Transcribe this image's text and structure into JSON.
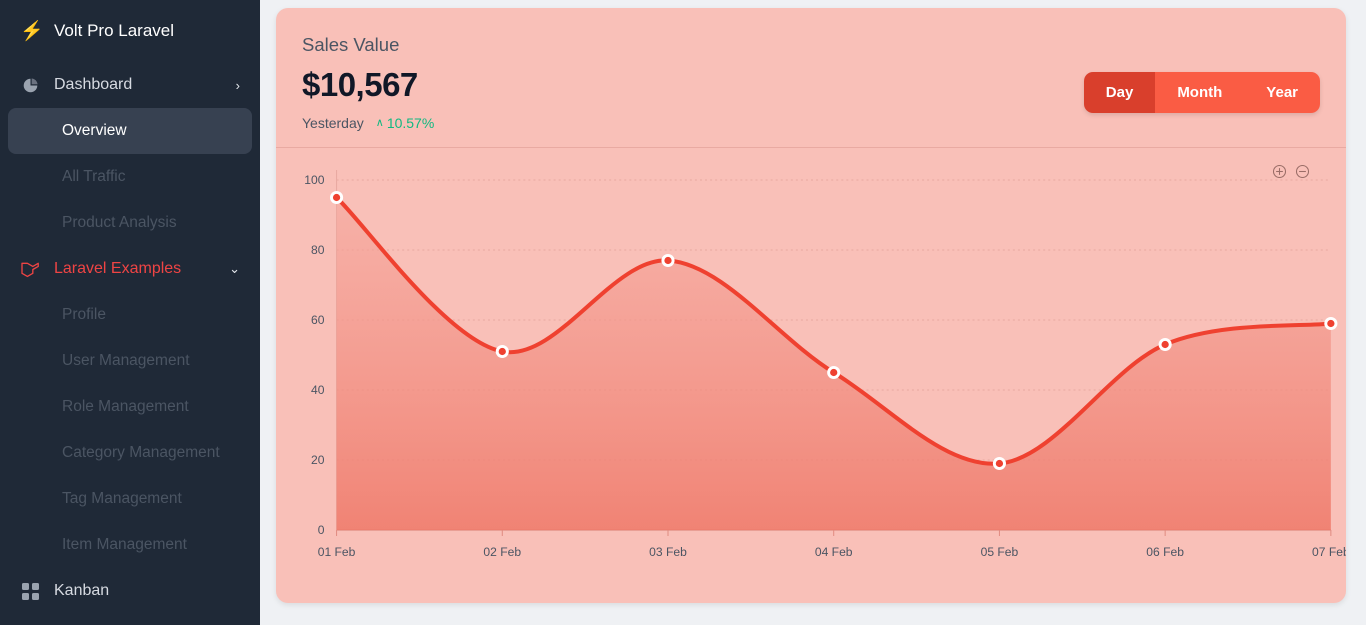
{
  "sidebar": {
    "brand": {
      "label": "Volt Pro Laravel",
      "icon": "bolt-icon"
    },
    "items": [
      {
        "label": "Dashboard",
        "icon": "pie-chart-icon",
        "chevron": "›",
        "state": "parent",
        "name": "dashboard"
      },
      {
        "label": "Overview",
        "icon": "",
        "chevron": "",
        "state": "active-sub",
        "name": "overview"
      },
      {
        "label": "All Traffic",
        "icon": "",
        "chevron": "",
        "state": "sub",
        "name": "all-traffic"
      },
      {
        "label": "Product Analysis",
        "icon": "",
        "chevron": "",
        "state": "sub",
        "name": "product-analysis"
      },
      {
        "label": "Laravel Examples",
        "icon": "laravel-icon",
        "chevron": "⌄",
        "state": "accent",
        "name": "laravel-examples"
      },
      {
        "label": "Profile",
        "icon": "",
        "chevron": "",
        "state": "sub",
        "name": "profile"
      },
      {
        "label": "User Management",
        "icon": "",
        "chevron": "",
        "state": "sub",
        "name": "user-management"
      },
      {
        "label": "Role Management",
        "icon": "",
        "chevron": "",
        "state": "sub",
        "name": "role-management"
      },
      {
        "label": "Category Management",
        "icon": "",
        "chevron": "",
        "state": "sub",
        "name": "category-management"
      },
      {
        "label": "Tag Management",
        "icon": "",
        "chevron": "",
        "state": "sub",
        "name": "tag-management"
      },
      {
        "label": "Item Management",
        "icon": "",
        "chevron": "",
        "state": "sub",
        "name": "item-management"
      },
      {
        "label": "Kanban",
        "icon": "kanban-icon",
        "chevron": "",
        "state": "parent",
        "name": "kanban"
      }
    ]
  },
  "card": {
    "title": "Sales Value",
    "value": "$10,567",
    "period_label": "Yesterday",
    "delta": "10.57%",
    "delta_caret": "∧",
    "range_buttons": [
      {
        "label": "Day",
        "active": true
      },
      {
        "label": "Month",
        "active": false
      },
      {
        "label": "Year",
        "active": false
      }
    ],
    "zoom_in_icon": "zoom-in-icon",
    "zoom_out_icon": "zoom-out-icon"
  },
  "colors": {
    "accent": "#fa5c44",
    "accent_dark": "#d93f2c",
    "card_bg": "#f9c0b8",
    "sidebar_bg": "#1f2937",
    "sidebar_active": "#374151",
    "page_bg": "#eff1f4",
    "positive": "#10b981",
    "laravel_red": "#ef4444"
  },
  "chart_data": {
    "type": "area",
    "title": "Sales Value",
    "xlabel": "",
    "ylabel": "",
    "categories": [
      "01 Feb",
      "02 Feb",
      "03 Feb",
      "04 Feb",
      "05 Feb",
      "06 Feb",
      "07 Feb"
    ],
    "values": [
      95,
      51,
      77,
      45,
      19,
      53,
      59
    ],
    "series": [
      {
        "name": "Sales Value",
        "values": [
          95,
          51,
          77,
          45,
          19,
          53,
          59
        ]
      }
    ],
    "ylim": [
      0,
      100
    ],
    "yticks": [
      0,
      20,
      40,
      60,
      80,
      100
    ],
    "grid": true,
    "legend": false,
    "curve": "smooth",
    "line_color": "#ef4130",
    "marker_fill": "#ef4130",
    "marker_stroke": "#ffffff"
  }
}
